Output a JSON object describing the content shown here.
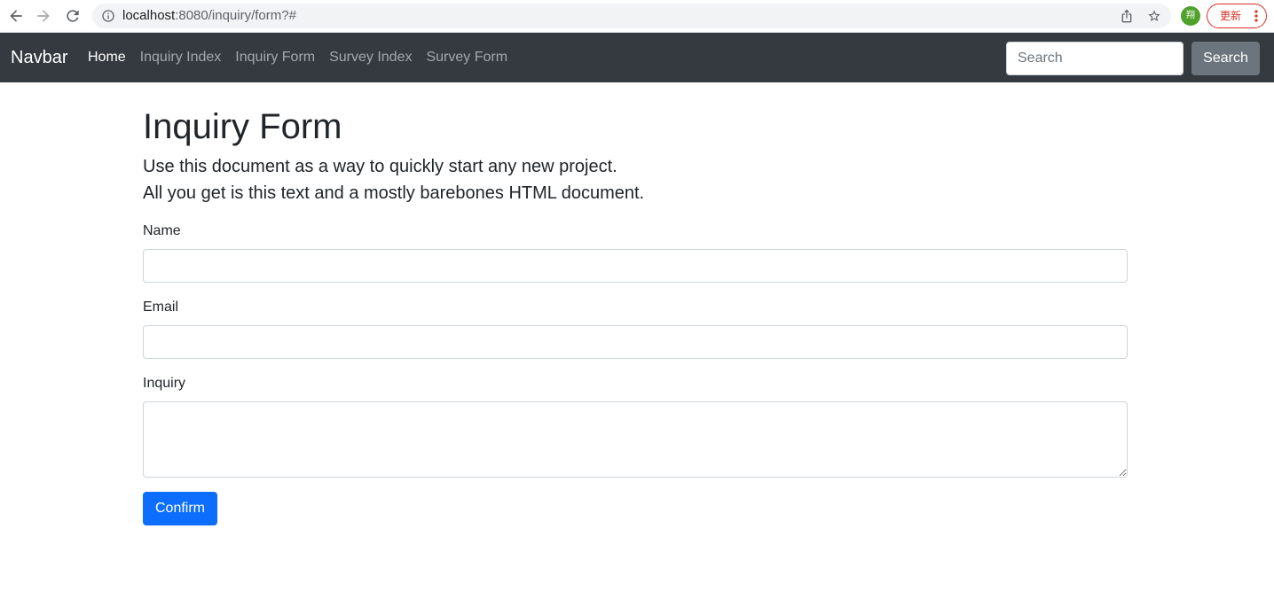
{
  "browser": {
    "url_host": "localhost",
    "url_rest": ":8080/inquiry/form?#",
    "avatar_initial": "翔",
    "update_label": "更新",
    "icons": {
      "back": "arrow-left-icon",
      "forward": "arrow-right-icon",
      "reload": "reload-icon",
      "site_info": "info-icon",
      "share": "share-icon",
      "bookmark": "star-icon",
      "menu": "kebab-menu-icon"
    }
  },
  "navbar": {
    "brand": "Navbar",
    "links": [
      {
        "label": "Home",
        "active": true
      },
      {
        "label": "Inquiry Index",
        "active": false
      },
      {
        "label": "Inquiry Form",
        "active": false
      },
      {
        "label": "Survey Index",
        "active": false
      },
      {
        "label": "Survey Form",
        "active": false
      }
    ],
    "search": {
      "placeholder": "Search",
      "value": "",
      "button_label": "Search"
    }
  },
  "page": {
    "title": "Inquiry Form",
    "lead": [
      "Use this document as a way to quickly start any new project.",
      "All you get is this text and a mostly barebones HTML document."
    ]
  },
  "form": {
    "name": {
      "label": "Name",
      "value": ""
    },
    "email": {
      "label": "Email",
      "value": ""
    },
    "inquiry": {
      "label": "Inquiry",
      "value": ""
    },
    "confirm_label": "Confirm"
  },
  "colors": {
    "navbar_bg": "#343a40",
    "primary": "#0d6efd",
    "secondary": "#6c757d",
    "avatar": "#4fa32b",
    "update_red": "#d93025"
  }
}
